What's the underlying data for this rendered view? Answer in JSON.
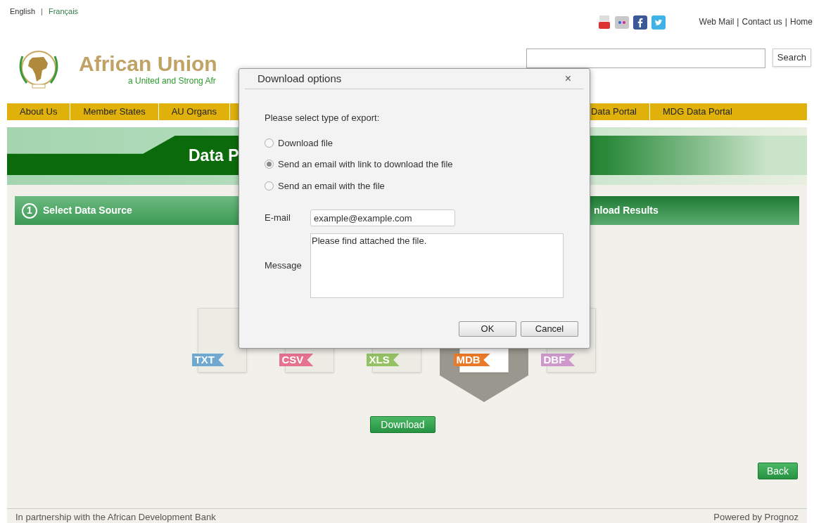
{
  "languages": [
    {
      "label": "English",
      "selected": true
    },
    {
      "label": "Français",
      "selected": false
    }
  ],
  "separator": "|",
  "top_links": [
    "Web Mail",
    "Contact us",
    "Home"
  ],
  "logo": {
    "title": "African Union",
    "tagline": "a United and Strong Afr"
  },
  "search": {
    "button": "Search"
  },
  "nav": [
    "About Us",
    "Member States",
    "AU Organs",
    "Data Portal",
    "MDG Data Portal"
  ],
  "banner": {
    "title": "Data P"
  },
  "steps": [
    {
      "number": "1",
      "label": "Select Data Source"
    },
    {
      "label": "nload Results"
    }
  ],
  "formats": [
    {
      "label": "TXT",
      "color": "#6fa8d0",
      "selected": false
    },
    {
      "label": "CSV",
      "color": "#e5728f",
      "selected": false
    },
    {
      "label": "XLS",
      "color": "#93c163",
      "selected": false
    },
    {
      "label": "MDB",
      "color": "#e87a2a",
      "selected": true
    },
    {
      "label": "DBF",
      "color": "#cf98cc",
      "selected": false
    }
  ],
  "download_button": "Download",
  "back_button": "Back",
  "footer": {
    "left": "In partnership with the African Development Bank",
    "right": "Powered by Prognoz"
  },
  "dialog": {
    "title": "Download options",
    "close": "×",
    "prompt": "Please select type of export:",
    "options": [
      {
        "label": "Download file",
        "selected": false
      },
      {
        "label": "Send an email with link to download the file",
        "selected": true
      },
      {
        "label": "Send an email with the file",
        "selected": false
      }
    ],
    "email_label": "E-mail",
    "email_value": "example@example.com",
    "message_label": "Message",
    "message_value": "Please find attached the file.",
    "buttons": [
      "OK",
      "Cancel"
    ]
  }
}
